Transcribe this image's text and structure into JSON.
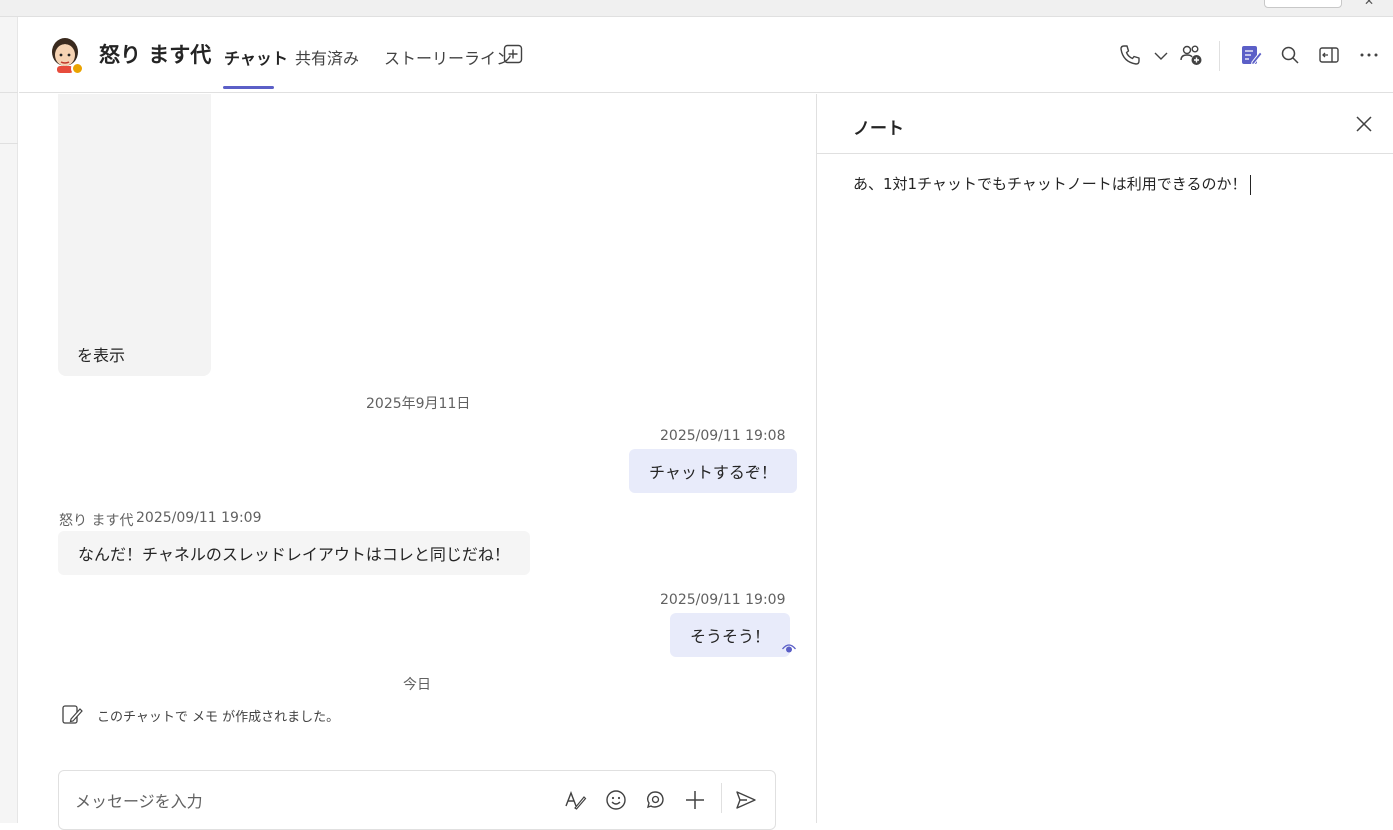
{
  "header": {
    "title": "怒り ます代",
    "tabs": [
      {
        "label": "チャット",
        "active": true
      },
      {
        "label": "共有済み",
        "active": false
      },
      {
        "label": "ストーリーライン",
        "active": false
      }
    ],
    "icons": [
      "call-icon",
      "chevron-down-icon",
      "add-people-icon",
      "notes-icon",
      "search-icon",
      "popout-icon",
      "more-icon"
    ],
    "accent_color": "#5b5fc7",
    "status_color": "#eaa300"
  },
  "chat": {
    "image_card_label": "を表示",
    "date_1": "2025年9月11日",
    "messages": [
      {
        "from": "me",
        "time": "2025/09/11 19:08",
        "text": "チャットするぞ！"
      },
      {
        "from": "other",
        "sender": "怒り ます代",
        "time": "2025/09/11 19:09",
        "text": "なんだ！チャネルのスレッドレイアウトはコレと同じだね！"
      },
      {
        "from": "me",
        "time": "2025/09/11 19:09",
        "text": "そうそう！"
      }
    ],
    "date_2": "今日",
    "system_message": "このチャットで メモ が作成されました。"
  },
  "compose": {
    "placeholder": "メッセージを入力",
    "icons": [
      "format-icon",
      "emoji-icon",
      "loop-icon",
      "add-icon",
      "send-icon"
    ]
  },
  "notes": {
    "title": "ノート",
    "content": "あ、1対1チャットでもチャットノートは利用できるのか！"
  }
}
